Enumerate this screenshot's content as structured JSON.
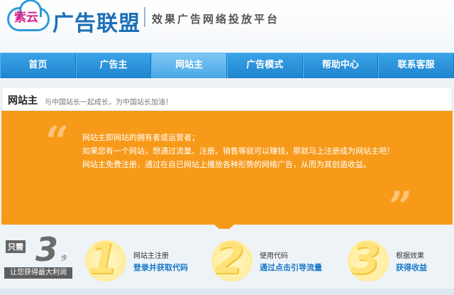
{
  "header": {
    "logo_badge": "紫云",
    "logo_name": "广告联盟",
    "slogan": "效果广告网络投放平台"
  },
  "nav": {
    "items": [
      {
        "label": "首页"
      },
      {
        "label": "广告主"
      },
      {
        "label": "网站主",
        "active": true
      },
      {
        "label": "广告模式"
      },
      {
        "label": "帮助中心"
      },
      {
        "label": "联系客服"
      }
    ]
  },
  "section": {
    "title": "网站主",
    "subtitle": "与中国站长一起成长，为中国站长加油！"
  },
  "panel": {
    "lines": [
      "网站主即网站的拥有者或运营者；",
      "如果您有一个网站，想通过流量、注册、销售等就可以赚钱，那就马上注册成为网站主吧！",
      "网站主免费注册，通过在自已网站上播放各种形势的网络广告，从而为其创造收益。"
    ],
    "quote_open": "“",
    "quote_close": "”"
  },
  "steps_intro": {
    "only": "只需",
    "number": "3",
    "unit": "步",
    "tagline": "让您获得最大利润"
  },
  "steps": [
    {
      "number": "1",
      "label": "网站主注册",
      "link": "登录并获取代码"
    },
    {
      "number": "2",
      "label": "使用代码",
      "link": "通过点击引导流量"
    },
    {
      "number": "3",
      "label": "根据效果",
      "link": "获得收益"
    }
  ],
  "colors": {
    "nav_blue": "#2b95dc",
    "panel_orange": "#f79a1a",
    "link_blue": "#1a78c8",
    "step_yellow": "#ffe27a"
  }
}
